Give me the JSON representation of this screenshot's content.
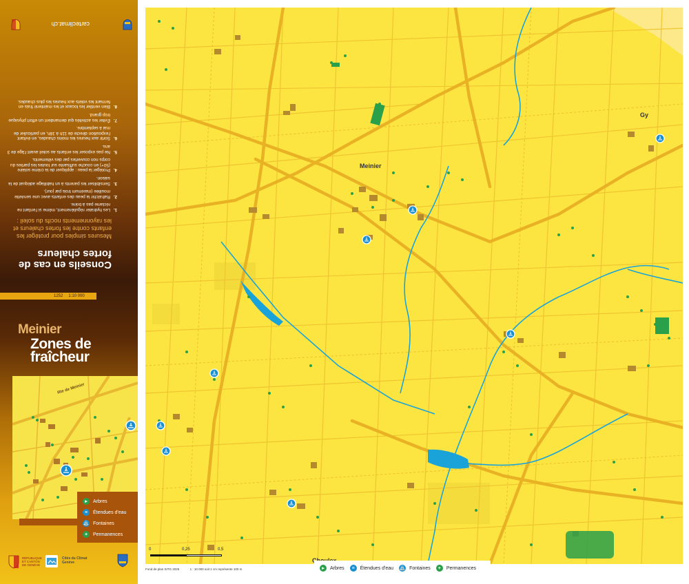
{
  "panel": {
    "url": "carteclimat.ch",
    "advice_title": "Conseils en cas de fortes chaleurs",
    "advice_subtitle": "Mesures simples pour protéger les enfants contre les fortes chaleurs et les rayonnements nocifs du soleil :",
    "advice": [
      {
        "n": "1.",
        "text": "Les hydrater régulièrement, même si l'enfant ne réclame pas à boire."
      },
      {
        "n": "2.",
        "text": "Rafraîchir la peau des enfants avec une serviette mouillée (maximum trois par jour)."
      },
      {
        "n": "3.",
        "text": "Sensibiliser les parents à un habillage adéquat de la saison."
      },
      {
        "n": "4.",
        "text": "Protéger la peau : appliquer de la crème solaire (50+) en couche suffisante sur toutes les parties du corps non couvertes par des vêtements."
      },
      {
        "n": "5.",
        "text": "Ne pas exposer les enfants au soleil avant l'âge de 3 ans."
      },
      {
        "n": "6.",
        "text": "Sortir aux heures les moins chaudes, en évitant l'exposition directe de 11h à 16h, en particulier de mai à septembre."
      },
      {
        "n": "7.",
        "text": "Éviter les activités qui demandent un effort physique trop grand."
      },
      {
        "n": "8.",
        "text": "Bien ventiler les locaux et les maintenir frais en fermant les volets aux heures les plus chaudes."
      }
    ],
    "scale_code": "1252",
    "scale_ratio": "1:10 000",
    "commune": "Meinier",
    "title": "Zones de fraîcheur",
    "inset_street": "Rte de Meinier",
    "inset_legend": [
      {
        "label": "Arbres",
        "color": "#2aa04a",
        "icon": "tree-icon"
      },
      {
        "label": "Étendues d'eau",
        "color": "#1a8fd0",
        "icon": "water-icon"
      },
      {
        "label": "Fontaines",
        "color": "#1a8fd0",
        "icon": "fountain-icon"
      },
      {
        "label": "Permanences",
        "color": "#2aa04a",
        "icon": "cross-icon"
      }
    ],
    "logo_republic": "RÉPUBLIQUE ET CANTON DE GENÈVE",
    "logo_cdc": "Cités du Climat Genève"
  },
  "map": {
    "places": [
      {
        "id": "meinier",
        "label": "Meinier"
      },
      {
        "id": "gy",
        "label": "Gy"
      },
      {
        "id": "choulex",
        "label": "Choulex"
      }
    ],
    "fountain_count": 12
  },
  "scalebar": {
    "labels": [
      "0",
      "0,25",
      "0,5"
    ],
    "unit": "km"
  },
  "legend": [
    {
      "label": "Arbres",
      "color": "#2aa04a",
      "icon": "tree-icon"
    },
    {
      "label": "Étendues d'eau",
      "color": "#1a8fd0",
      "icon": "water-icon"
    },
    {
      "label": "Fontaines",
      "color": "#1a8fd0",
      "icon": "fountain-icon"
    },
    {
      "label": "Permanences",
      "color": "#2aa04a",
      "icon": "cross-icon"
    }
  ],
  "footer": {
    "source": "Fond de plan SITG 2025",
    "scale_note": "1 : 10 000 soit 1 cm représente 100 m"
  }
}
